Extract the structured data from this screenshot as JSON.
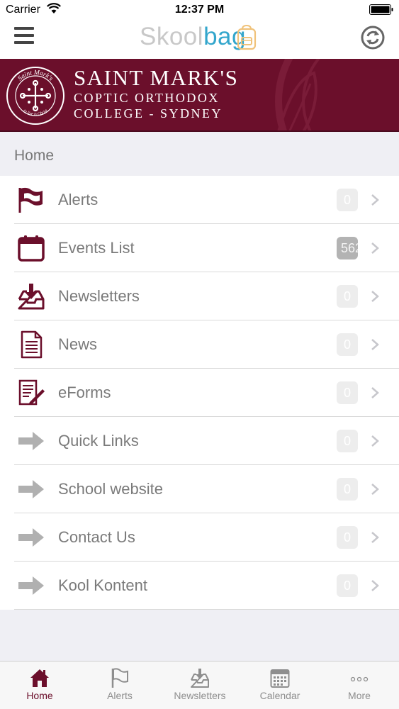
{
  "status_bar": {
    "carrier": "Carrier",
    "time": "12:37 PM"
  },
  "nav": {
    "logo_part1": "Skool",
    "logo_part2": "bag"
  },
  "banner": {
    "crest_text": "Saint Mark's",
    "crest_motto": "to live is Christ",
    "line1": "SAINT MARK'S",
    "line2": "COPTIC ORTHODOX",
    "line3": "COLLEGE - SYDNEY"
  },
  "section": {
    "title": "Home"
  },
  "menu_items": [
    {
      "label": "Alerts",
      "badge": "0",
      "icon": "flag-icon"
    },
    {
      "label": "Events List",
      "badge": "562",
      "icon": "calendar-icon"
    },
    {
      "label": "Newsletters",
      "badge": "0",
      "icon": "inbox-download-icon"
    },
    {
      "label": "News",
      "badge": "0",
      "icon": "document-icon"
    },
    {
      "label": "eForms",
      "badge": "0",
      "icon": "form-pen-icon"
    },
    {
      "label": "Quick Links",
      "badge": "0",
      "icon": "arrow-right-icon"
    },
    {
      "label": "School website",
      "badge": "0",
      "icon": "arrow-right-icon"
    },
    {
      "label": "Contact Us",
      "badge": "0",
      "icon": "arrow-right-icon"
    },
    {
      "label": "Kool Kontent",
      "badge": "0",
      "icon": "arrow-right-icon"
    }
  ],
  "tabs": [
    {
      "label": "Home",
      "icon": "home-icon",
      "active": true
    },
    {
      "label": "Alerts",
      "icon": "flag-icon",
      "active": false
    },
    {
      "label": "Newsletters",
      "icon": "inbox-download-icon",
      "active": false
    },
    {
      "label": "Calendar",
      "icon": "calendar-icon",
      "active": false
    },
    {
      "label": "More",
      "icon": "ellipsis-icon",
      "active": false
    }
  ],
  "colors": {
    "brand": "#6b0f2b",
    "accent": "#33a6cc",
    "text_muted": "#7a7a7a"
  }
}
